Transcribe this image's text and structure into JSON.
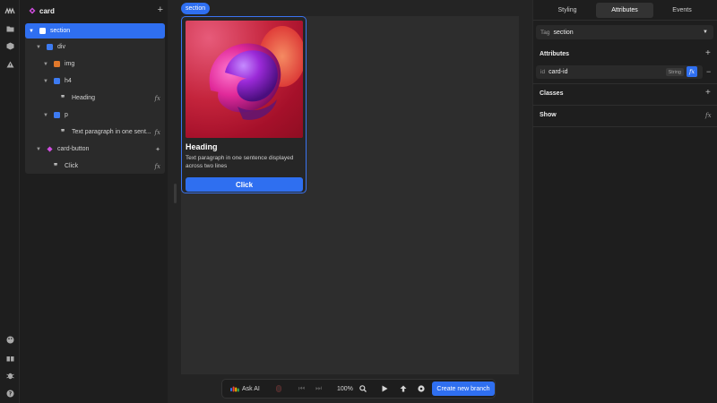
{
  "colors": {
    "accent": "#2f6ff0",
    "panel": "#1e1e1e",
    "canvas": "#2d2d2d"
  },
  "rail": {
    "icons": [
      "logo-icon",
      "folder-icon",
      "cube-icon",
      "warning-icon",
      "palette-icon",
      "gift-icon",
      "bug-icon",
      "help-icon"
    ]
  },
  "tree": {
    "title": "card",
    "add_label": "+",
    "items": [
      {
        "label": "section",
        "selected": true
      },
      {
        "label": "div"
      },
      {
        "label": "img"
      },
      {
        "label": "h4"
      },
      {
        "label": "Heading",
        "fx": "fx"
      },
      {
        "label": "p"
      },
      {
        "label": "Text paragraph in one sent...",
        "fx": "fx"
      },
      {
        "label": "card-button"
      },
      {
        "label": "Click",
        "fx": "fx"
      }
    ]
  },
  "canvas": {
    "section_tag": "section",
    "card": {
      "heading": "Heading",
      "text": "Text paragraph in one sentence displayed across two lines",
      "button": "Click"
    }
  },
  "toolbar": {
    "ask_ai": "Ask AI",
    "zoom": "100%",
    "create_branch": "Create new branch"
  },
  "right_panel": {
    "tabs": [
      "Styling",
      "Attributes",
      "Events"
    ],
    "active_tab": "Attributes",
    "tag_label": "Tag",
    "tag_value": "section",
    "attributes_title": "Attributes",
    "attr_key_prefix": "id",
    "attr_value": "card-id",
    "attr_type": "String",
    "attr_fx": "fx",
    "attr_remove": "−",
    "classes_title": "Classes",
    "show_title": "Show",
    "show_fx": "fx",
    "plus": "+"
  }
}
